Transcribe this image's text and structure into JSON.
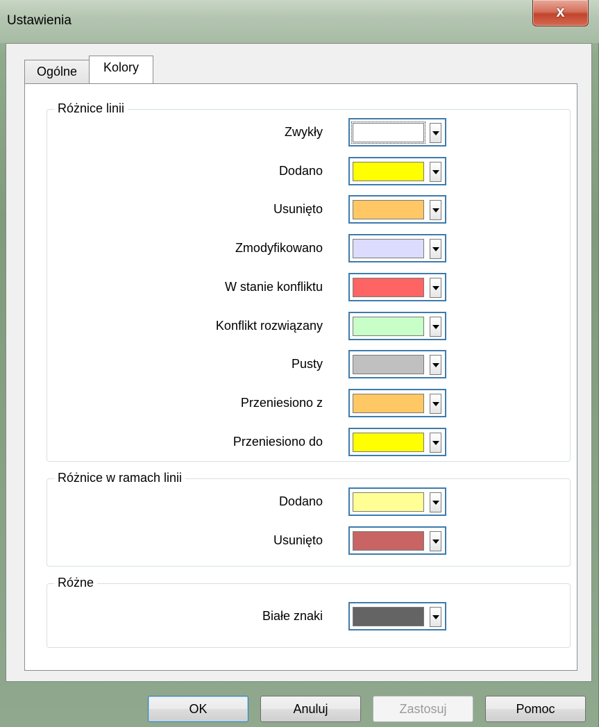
{
  "window": {
    "title": "Ustawienia",
    "close_label": "x"
  },
  "tabs": [
    {
      "label": "Ogólne",
      "active": false
    },
    {
      "label": "Kolory",
      "active": true
    }
  ],
  "groups": {
    "line_diff": {
      "title": "Różnice linii",
      "rows": [
        {
          "label": "Zwykły",
          "color": "#ffffff"
        },
        {
          "label": "Dodano",
          "color": "#ffff00"
        },
        {
          "label": "Usunięto",
          "color": "#ffc864"
        },
        {
          "label": "Zmodyfikowano",
          "color": "#dcdcff"
        },
        {
          "label": "W stanie konfliktu",
          "color": "#ff6464"
        },
        {
          "label": "Konflikt rozwiązany",
          "color": "#c8ffc8"
        },
        {
          "label": "Pusty",
          "color": "#c0c0c0"
        },
        {
          "label": "Przeniesiono z",
          "color": "#ffc864"
        },
        {
          "label": "Przeniesiono do",
          "color": "#ffff00"
        }
      ]
    },
    "inline_diff": {
      "title": "Różnice w ramach linii",
      "rows": [
        {
          "label": "Dodano",
          "color": "#ffff96"
        },
        {
          "label": "Usunięto",
          "color": "#c86464"
        }
      ]
    },
    "misc": {
      "title": "Różne",
      "rows": [
        {
          "label": "Białe znaki",
          "color": "#646464"
        }
      ]
    }
  },
  "buttons": {
    "ok": "OK",
    "cancel": "Anuluj",
    "apply": "Zastosuj",
    "help": "Pomoc"
  }
}
